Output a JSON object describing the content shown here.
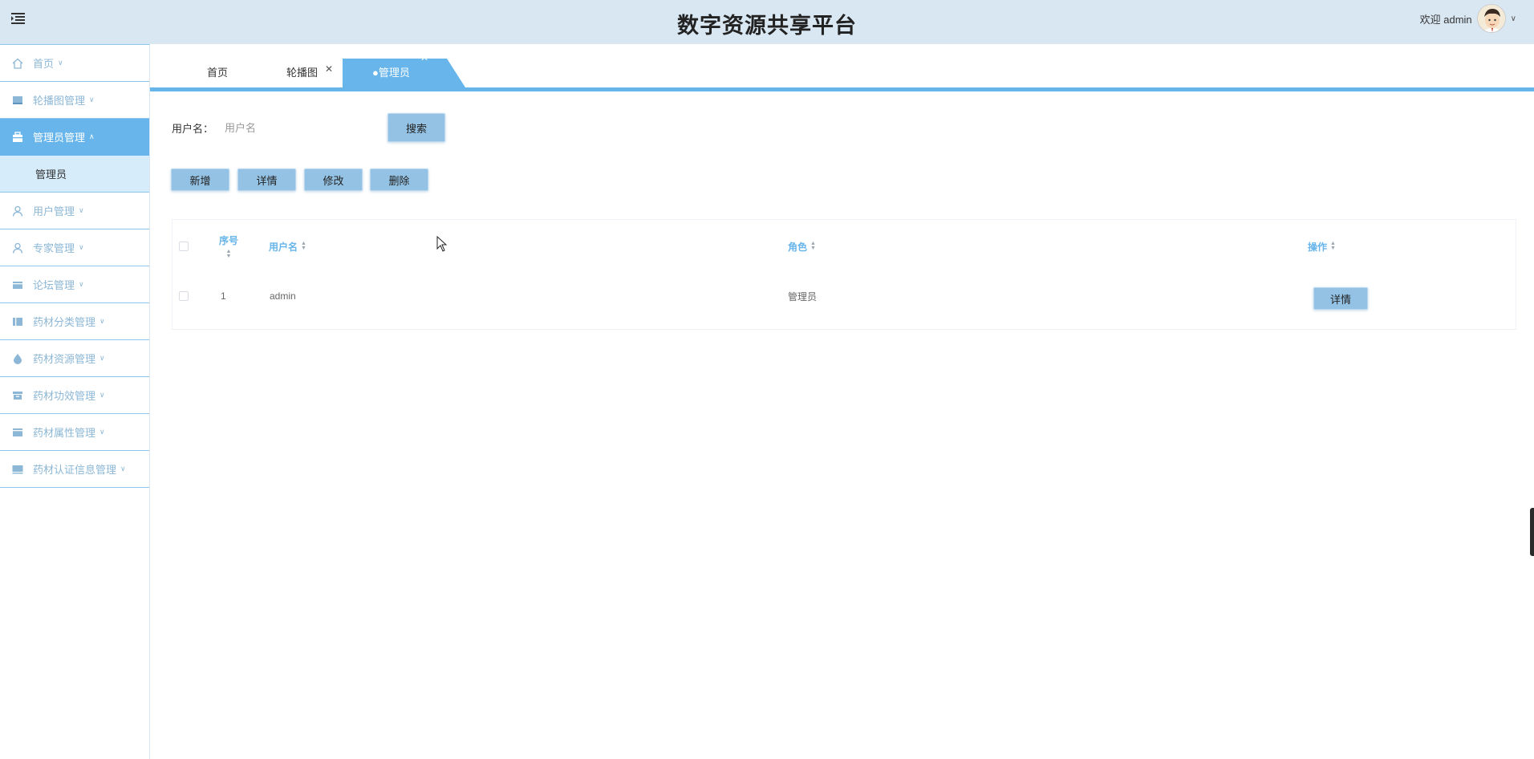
{
  "header": {
    "title": "数字资源共享平台",
    "welcome": "欢迎 admin"
  },
  "sidebar": {
    "items": [
      {
        "label": "首页",
        "icon": "home-icon",
        "expanded": false
      },
      {
        "label": "轮播图管理",
        "icon": "carousel-icon",
        "expanded": false
      },
      {
        "label": "管理员管理",
        "icon": "admin-icon",
        "expanded": true,
        "active": true
      },
      {
        "label": "用户管理",
        "icon": "user-icon",
        "expanded": false
      },
      {
        "label": "专家管理",
        "icon": "expert-icon",
        "expanded": false
      },
      {
        "label": "论坛管理",
        "icon": "forum-icon",
        "expanded": false
      },
      {
        "label": "药材分类管理",
        "icon": "category-icon",
        "expanded": false
      },
      {
        "label": "药材资源管理",
        "icon": "drop-icon",
        "expanded": false
      },
      {
        "label": "药材功效管理",
        "icon": "box-icon",
        "expanded": false
      },
      {
        "label": "药材属性管理",
        "icon": "card-icon",
        "expanded": false
      },
      {
        "label": "药材认证信息管理",
        "icon": "monitor-icon",
        "expanded": false
      }
    ],
    "subitem": "管理员"
  },
  "tabs": [
    {
      "label": "首页",
      "closable": false,
      "active": false
    },
    {
      "label": "轮播图",
      "closable": true,
      "active": false
    },
    {
      "label": "●管理员",
      "closable": true,
      "active": true
    }
  ],
  "search": {
    "label": "用户名：",
    "placeholder": "用户名",
    "value": "",
    "button": "搜索"
  },
  "actions": {
    "add": "新增",
    "detail": "详情",
    "edit": "修改",
    "delete": "删除"
  },
  "table": {
    "columns": [
      "序号",
      "用户名",
      "角色",
      "操作"
    ],
    "rows": [
      {
        "index": "1",
        "username": "admin",
        "role": "管理员",
        "action": "详情"
      }
    ]
  },
  "colors": {
    "accent": "#67b5ea",
    "header_bg": "#d9e7f3",
    "button_bg": "#93c2e4"
  }
}
